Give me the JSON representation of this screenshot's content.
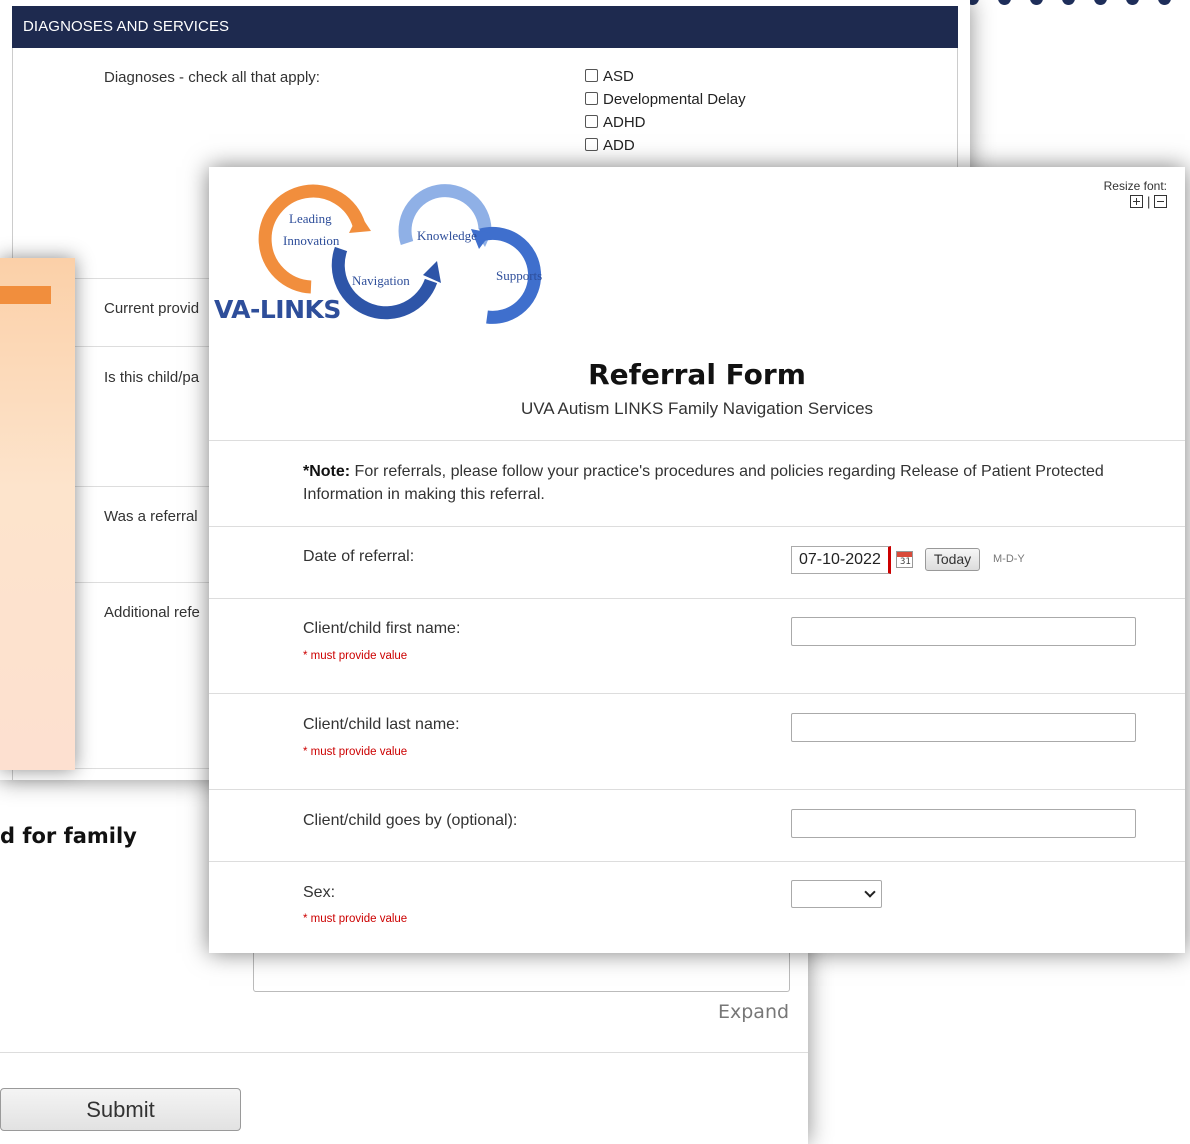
{
  "diagnoses_panel": {
    "header": "DIAGNOSES AND SERVICES",
    "diagnoses_label": "Diagnoses - check all that apply:",
    "diagnoses_options": [
      "ASD",
      "Developmental Delay",
      "ADHD",
      "ADD"
    ],
    "current_provider_label": "Current provid",
    "is_this_child_label": "Is this child/pa",
    "was_referral_label": "Was a referral",
    "additional_label": "Additional refe"
  },
  "bottom_panel": {
    "heading": "d for family",
    "expand_label": "Expand",
    "submit_label": "Submit"
  },
  "referral_form": {
    "resize_font_label": "Resize font:",
    "resize_separator": "|",
    "logo": {
      "brand": "VA-LINKS",
      "words": [
        "Leading",
        "Innovation",
        "Navigation",
        "Knowledge",
        "Supports"
      ]
    },
    "title": "Referral Form",
    "subtitle": "UVA Autism LINKS Family Navigation Services",
    "note_label": "*Note:",
    "note_text": " For referrals, please follow your practice's procedures and policies regarding Release of Patient Protected Information in making this referral.",
    "date_label": "Date of referral:",
    "date_value": "07-10-2022",
    "calendar_glyph": "31",
    "today_label": "Today",
    "date_format": "M-D-Y",
    "first_name_label": "Client/child first name:",
    "last_name_label": "Client/child last name:",
    "goes_by_label": "Client/child goes by (optional):",
    "sex_label": "Sex:",
    "required_text": "* must provide value"
  },
  "colors": {
    "header_navy": "#1e2a4f",
    "logo_orange": "#f18e3d",
    "logo_blue": "#2e4e9a",
    "logo_light_blue": "#8fb0e6",
    "required_red": "#cc0000"
  }
}
